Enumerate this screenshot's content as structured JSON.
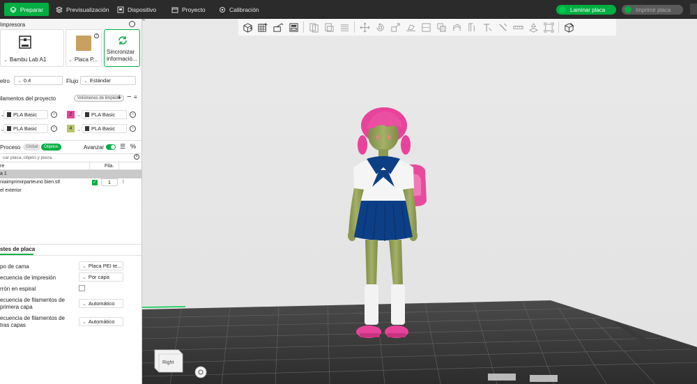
{
  "topbar": {
    "tabs": [
      {
        "label": "Preparar",
        "active": true
      },
      {
        "label": "Previsualización"
      },
      {
        "label": "Dispositivo"
      },
      {
        "label": "Proyecto"
      },
      {
        "label": "Calibración"
      }
    ],
    "slice_button": "Laminar placa",
    "print_button": "Imprimir placa"
  },
  "printer": {
    "section_title": "Impresora",
    "printer_name": "Bambu Lab A1",
    "plate_name": "Placa P...",
    "sync_label_line1": "Sincronizar",
    "sync_label_line2": "informació...",
    "diameter_label": "etro",
    "diameter_value": "0.4",
    "flow_label": "Flujo",
    "flow_value": "Estándar"
  },
  "filaments": {
    "title": "ilamentos del proyecto",
    "purge_button": "Volúmenes de limpieza",
    "items": [
      {
        "number": "",
        "name": "PLA Basic",
        "color": "#ffffff"
      },
      {
        "number": "2",
        "name": "PLA Basic",
        "color": "#e8439b"
      },
      {
        "number": "",
        "name": "PLA Basic",
        "color": "#ffffff"
      },
      {
        "number": "4",
        "name": "PLA Basic",
        "color": "#b9c46a"
      }
    ]
  },
  "process": {
    "title": "Proceso",
    "global_label": "Global",
    "objects_label": "Objetos",
    "advanced_label": "Avanzar",
    "search_placeholder": "car placa, objeto y pieza.",
    "col_name": "re",
    "col_filament": "Fila.",
    "plate_row": "a 1",
    "object_name": "niaimprimirparteuno bien.stl",
    "object_filament": "1",
    "outer_wall": "el exterior"
  },
  "plate_settings": {
    "tab_label": "stes de placa",
    "rows": [
      {
        "label": "po de cama",
        "value": "Placa PEI te..."
      },
      {
        "label": "ecuencia de impresión",
        "value": "Por capa"
      },
      {
        "label": "rrón en espiral",
        "value": ""
      },
      {
        "label": "ecuencia de filamentos de",
        "label2": "primera capa",
        "value": "Automático"
      },
      {
        "label": "ecuencia de filamentos de",
        "label2": "tras capas",
        "value": "Automático"
      }
    ]
  },
  "viewport": {
    "view_cube_label": "Right"
  },
  "colors": {
    "accent": "#00ae42",
    "toolbar_bg": "#2b2b2b",
    "model_hair": "#e8439b",
    "model_skin": "#9aa85c",
    "model_uniform": "#0d3f86"
  }
}
